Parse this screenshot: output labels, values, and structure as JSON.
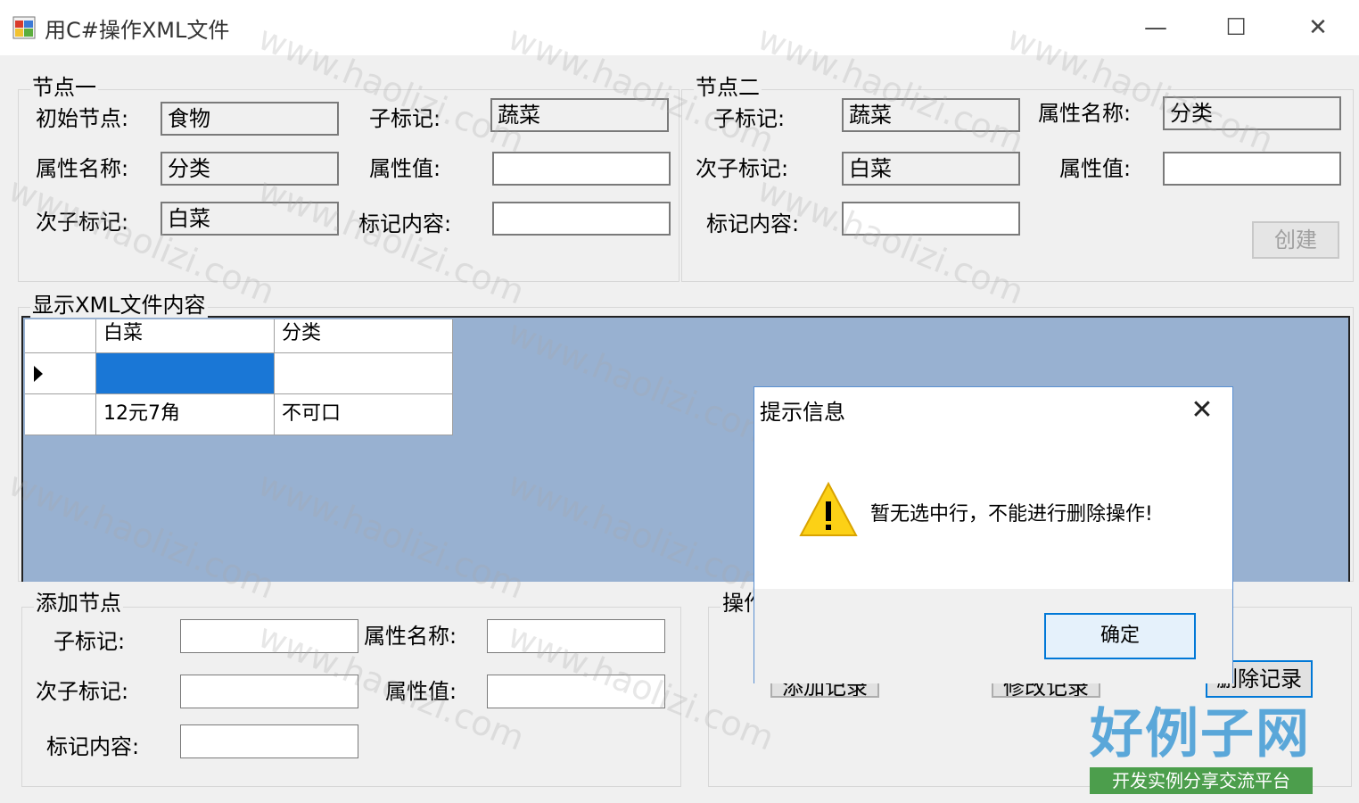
{
  "window": {
    "title": "用C#操作XML文件"
  },
  "node1": {
    "group_label": "节点一",
    "labels": {
      "init_node": "初始节点:",
      "attr_name": "属性名称:",
      "sub_child": "次子标记:",
      "child_tag": "子标记:",
      "attr_value": "属性值:",
      "content": "标记内容:"
    },
    "values": {
      "init_node": "食物",
      "attr_name": "分类",
      "sub_child": "白菜",
      "child_tag": "蔬菜",
      "attr_value": "",
      "content": ""
    }
  },
  "node2": {
    "group_label": "节点二",
    "labels": {
      "child_tag": "子标记:",
      "sub_child": "次子标记:",
      "content": "标记内容:",
      "attr_name": "属性名称:",
      "attr_value": "属性值:"
    },
    "values": {
      "child_tag": "蔬菜",
      "sub_child": "白菜",
      "content": "",
      "attr_name": "分类",
      "attr_value": ""
    },
    "create_button": "创建"
  },
  "xml_view": {
    "group_label": "显示XML文件内容",
    "columns": [
      "白菜",
      "分类"
    ],
    "rows": [
      [
        "",
        ""
      ],
      [
        "12元7角",
        "不可口"
      ]
    ]
  },
  "add_node": {
    "group_label": "添加节点",
    "labels": {
      "child_tag": "子标记:",
      "sub_child": "次子标记:",
      "content": "标记内容:",
      "attr_name": "属性名称:",
      "attr_value": "属性值:"
    },
    "values": {
      "child_tag": "",
      "sub_child": "",
      "content": "",
      "attr_name": "",
      "attr_value": ""
    }
  },
  "operations": {
    "group_label": "操作",
    "add_button": "添加记录",
    "modify_button": "修改记录",
    "delete_button": "删除记录"
  },
  "dialog": {
    "title": "提示信息",
    "message": "暂无选中行，不能进行删除操作!",
    "ok_button": "确定",
    "icon": "warning-icon"
  },
  "watermark": {
    "text": "www.haolizi.com",
    "logo_title": "好例子网",
    "logo_subtitle": "开发实例分享交流平台"
  }
}
